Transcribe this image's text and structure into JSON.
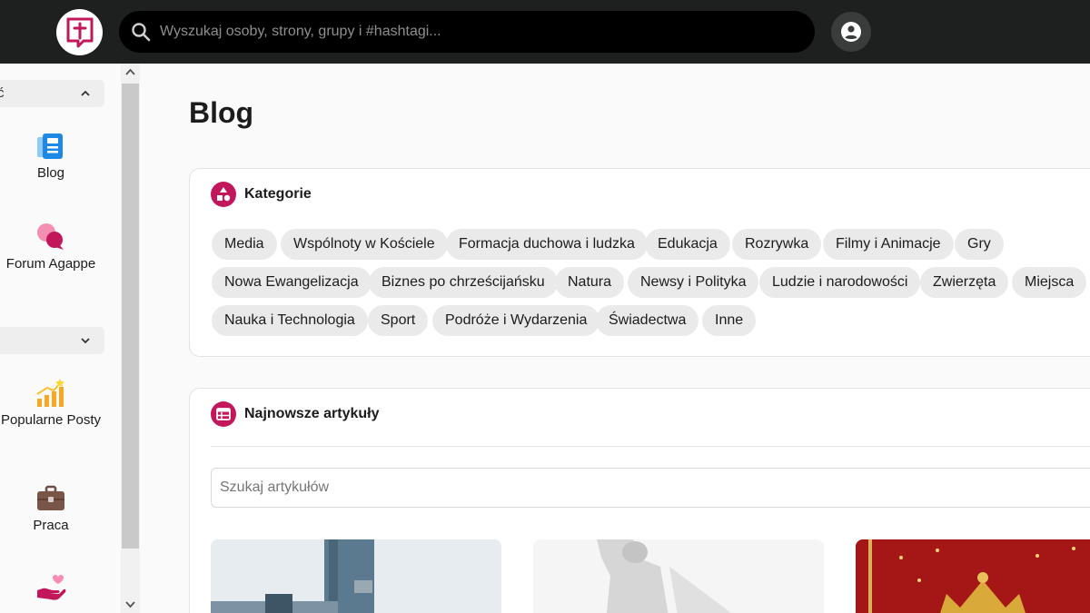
{
  "header": {
    "search_placeholder": "Wyszukaj osoby, strony, grupy i #hashtagi..."
  },
  "sidebar": {
    "section1_label": "ć",
    "items": [
      {
        "label": "Blog",
        "icon": "blog-icon"
      },
      {
        "label": "Forum Agappe",
        "icon": "chat-bubbles-icon"
      },
      {
        "label": "Popularne Posty",
        "icon": "trending-chart-icon"
      },
      {
        "label": "Praca",
        "icon": "briefcase-icon"
      },
      {
        "label": "",
        "icon": "heart-hand-icon"
      }
    ]
  },
  "main": {
    "title": "Blog",
    "categories": {
      "heading": "Kategorie",
      "chips": [
        "Media",
        "Wspólnoty w Kościele",
        "Formacja duchowa i ludzka",
        "Edukacja",
        "Rozrywka",
        "Filmy i Animacje",
        "Gry",
        "Nowa Ewangelizacja",
        "Biznes po chrześcijańsku",
        "Natura",
        "Newsy i Polityka",
        "Ludzie i narodowości",
        "Zwierzęta",
        "Miejsca",
        "Nauka i Technologia",
        "Sport",
        "Podróże i Wydarzenia",
        "Świadectwa",
        "Inne"
      ]
    },
    "articles": {
      "heading": "Najnowsze artykuły",
      "search_placeholder": "Szukaj artykułów"
    }
  },
  "colors": {
    "accent": "#c2185b",
    "topbar": "#1e2020"
  }
}
